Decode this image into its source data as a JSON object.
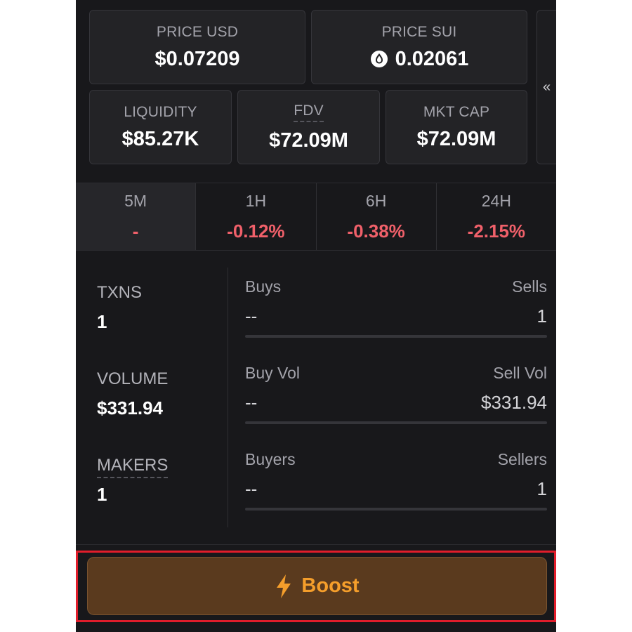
{
  "price": {
    "usd_label": "PRICE USD",
    "usd_value": "$0.07209",
    "sui_label": "PRICE SUI",
    "sui_value": "0.02061"
  },
  "metrics": {
    "liquidity_label": "LIQUIDITY",
    "liquidity_value": "$85.27K",
    "fdv_label": "FDV",
    "fdv_value": "$72.09M",
    "mktcap_label": "MKT CAP",
    "mktcap_value": "$72.09M"
  },
  "collapse_glyph": "«",
  "timeframes": [
    {
      "label": "5M",
      "value": "-"
    },
    {
      "label": "1H",
      "value": "-0.12%"
    },
    {
      "label": "6H",
      "value": "-0.38%"
    },
    {
      "label": "24H",
      "value": "-2.15%"
    }
  ],
  "stats": {
    "txns_label": "TXNS",
    "txns_value": "1",
    "volume_label": "VOLUME",
    "volume_value": "$331.94",
    "makers_label": "MAKERS",
    "makers_value": "1"
  },
  "pairs": {
    "buys_label": "Buys",
    "buys_value": "--",
    "sells_label": "Sells",
    "sells_value": "1",
    "buyvol_label": "Buy Vol",
    "buyvol_value": "--",
    "sellvol_label": "Sell Vol",
    "sellvol_value": "$331.94",
    "buyers_label": "Buyers",
    "buyers_value": "--",
    "sellers_label": "Sellers",
    "sellers_value": "1"
  },
  "boost": {
    "label": "Boost",
    "icon": "lightning-icon"
  },
  "colors": {
    "negative": "#f0606a",
    "boost_text": "#f59e2b",
    "boost_bg": "#5a3a1e",
    "highlight": "#e11d2b"
  }
}
